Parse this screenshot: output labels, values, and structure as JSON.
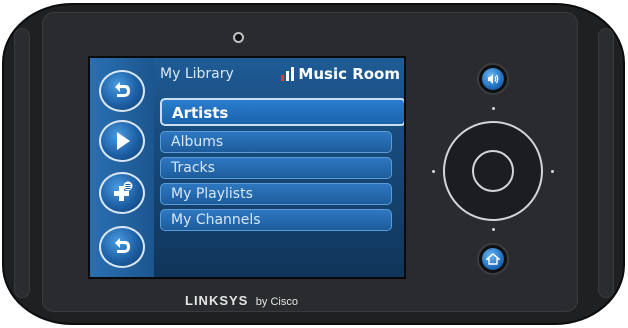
{
  "header": {
    "library_label": "My Library",
    "room_label": "Music Room"
  },
  "menu": {
    "items": [
      {
        "label": "Artists",
        "selected": true
      },
      {
        "label": "Albums",
        "selected": false
      },
      {
        "label": "Tracks",
        "selected": false
      },
      {
        "label": "My Playlists",
        "selected": false
      },
      {
        "label": "My Channels",
        "selected": false
      }
    ]
  },
  "left_buttons": [
    {
      "icon": "back-icon"
    },
    {
      "icon": "play-icon"
    },
    {
      "icon": "add-to-queue-icon"
    },
    {
      "icon": "back-icon"
    }
  ],
  "controls": {
    "volume_icon": "speaker-icon",
    "home_icon": "home-icon"
  },
  "brand": {
    "main": "LINKSYS",
    "sub": "by Cisco"
  },
  "colors": {
    "screen_blue": "#1c568f",
    "accent_blue": "#2e78c1",
    "signal_red": "#e23a2f"
  }
}
